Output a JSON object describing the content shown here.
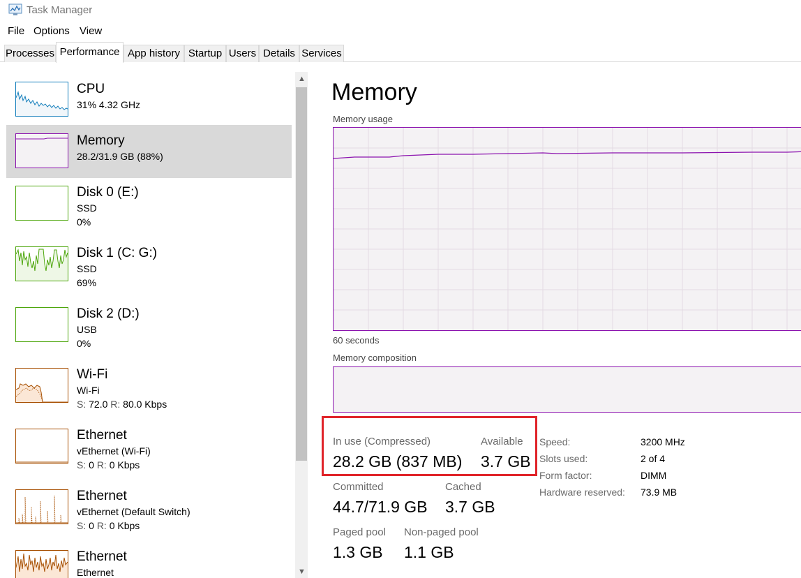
{
  "window": {
    "title": "Task Manager",
    "app_icon": "task-manager-icon"
  },
  "menu": {
    "items": [
      "File",
      "Options",
      "View"
    ]
  },
  "tabs": {
    "items": [
      "Processes",
      "Performance",
      "App history",
      "Startup",
      "Users",
      "Details",
      "Services"
    ],
    "active": "Performance"
  },
  "sidebar": {
    "items": [
      {
        "title": "CPU",
        "line1": "31%  4.32 GHz",
        "line2": "",
        "color": "#117dbb"
      },
      {
        "title": "Memory",
        "line1": "28.2/31.9 GB (88%)",
        "line2": "",
        "color": "#8b12ae"
      },
      {
        "title": "Disk 0 (E:)",
        "line1": "SSD",
        "line2": "0%",
        "color": "#4da60c"
      },
      {
        "title": "Disk 1 (C: G:)",
        "line1": "SSD",
        "line2": "69%",
        "color": "#4da60c"
      },
      {
        "title": "Disk 2 (D:)",
        "line1": "USB",
        "line2": "0%",
        "color": "#4da60c"
      },
      {
        "title": "Wi-Fi",
        "line1": "Wi-Fi",
        "line2_s": "S:",
        "line2_sv": " 72.0 ",
        "line2_r": "R:",
        "line2_rv": " 80.0 Kbps",
        "color": "#a74f01"
      },
      {
        "title": "Ethernet",
        "line1": "vEthernet (Wi-Fi)",
        "line2_s": "S:",
        "line2_sv": " 0 ",
        "line2_r": "R:",
        "line2_rv": " 0 Kbps",
        "color": "#a74f01"
      },
      {
        "title": "Ethernet",
        "line1": "vEthernet (Default Switch)",
        "line2_s": "S:",
        "line2_sv": " 0 ",
        "line2_r": "R:",
        "line2_rv": " 0 Kbps",
        "color": "#a74f01"
      },
      {
        "title": "Ethernet",
        "line1": "Ethernet",
        "line2": "",
        "color": "#a74f01"
      }
    ],
    "selected": "Memory"
  },
  "memory": {
    "title": "Memory",
    "usage_label": "Memory usage",
    "time_label": "60 seconds",
    "composition_label": "Memory composition",
    "usage_level": 0.88,
    "in_use_label": "In use (Compressed)",
    "in_use_value": "28.2 GB (837 MB)",
    "available_label": "Available",
    "available_value": "3.7 GB",
    "committed_label": "Committed",
    "committed_value": "44.7/71.9 GB",
    "cached_label": "Cached",
    "cached_value": "3.7 GB",
    "paged_label": "Paged pool",
    "paged_value": "1.3 GB",
    "nonpaged_label": "Non-paged pool",
    "nonpaged_value": "1.1 GB",
    "details": [
      {
        "label": "Speed:",
        "value": "3200 MHz"
      },
      {
        "label": "Slots used:",
        "value": "2 of 4"
      },
      {
        "label": "Form factor:",
        "value": "DIMM"
      },
      {
        "label": "Hardware reserved:",
        "value": "73.9 MB"
      }
    ],
    "accent": "#8b12ae",
    "highlight_color": "#e0242a"
  }
}
